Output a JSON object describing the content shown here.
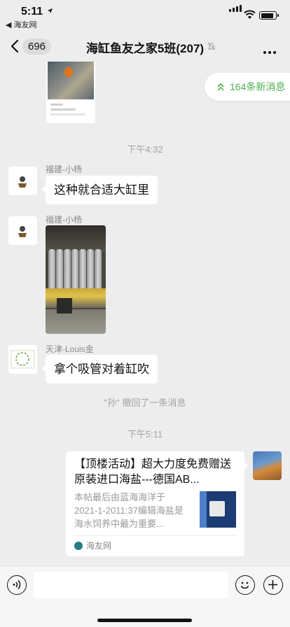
{
  "status_bar": {
    "time": "5:11",
    "back_app_label": "◀ 海友网",
    "battery_level": 0.9,
    "signal_bars": 4
  },
  "nav": {
    "unread_count": "696",
    "title": "海缸鱼友之家5班(207)",
    "muted": true
  },
  "new_messages_pill": "164条新消息",
  "messages": [
    {
      "type": "timestamp",
      "text": "下午4:32"
    },
    {
      "type": "text",
      "sender": "福建-小杨",
      "text": "这种就合适大缸里"
    },
    {
      "type": "image",
      "sender": "福建-小杨"
    },
    {
      "type": "text",
      "sender": "天津-Louis金",
      "text": "拿个吸管对着缸吹"
    },
    {
      "type": "recall",
      "text": "\"孙\" 撤回了一条消息"
    },
    {
      "type": "timestamp",
      "text": "下午5:11"
    },
    {
      "type": "link_card",
      "sender": "me",
      "title": "【顶楼活动】超大力度免费赠送原装进口海盐---德国AB...",
      "description": "本帖最后由蓝海海洋于2021-1-2011:37编辑海盐是海水饲养中最为重要...",
      "source": "海友网"
    }
  ],
  "colors": {
    "background": "#ededed",
    "bubble": "#ffffff",
    "accent_green": "#4caf50",
    "meta_text": "#a3a3a3"
  }
}
